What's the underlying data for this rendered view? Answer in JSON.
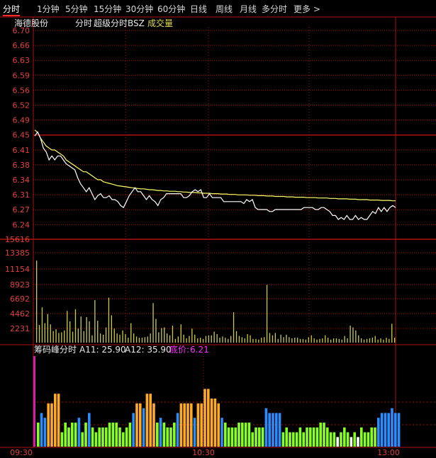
{
  "tabs": [
    {
      "label": "分时",
      "active": true
    },
    {
      "label": "1分钟"
    },
    {
      "label": "5分钟"
    },
    {
      "label": "15分钟"
    },
    {
      "label": "30分钟"
    },
    {
      "label": "60分钟"
    },
    {
      "label": "日线"
    },
    {
      "label": "周线"
    },
    {
      "label": "月线"
    },
    {
      "label": "多分时"
    },
    {
      "label": "更多 >"
    }
  ],
  "header": {
    "stock": "海德股份",
    "mode": "分时",
    "indicator": "超级分时BSZ",
    "volume": "成交量"
  },
  "price_ticks": [
    "6.70",
    "6.66",
    "6.63",
    "6.59",
    "6.56",
    "6.52",
    "6.49",
    "6.45",
    "6.41",
    "6.38",
    "6.34",
    "6.31",
    "6.27",
    "6.24"
  ],
  "volume_ticks": [
    "15616",
    "13385",
    "11154",
    "8923",
    "6692",
    "4462",
    "2231"
  ],
  "indicator_header": {
    "name": "筹码峰分时",
    "a11_label": "A11: 25.90",
    "a12_label": "A12: 35.90",
    "floor_label": "底价:",
    "floor_value": "6.21"
  },
  "time_labels": [
    "09:30",
    "10:30",
    "13:00"
  ],
  "colors": {
    "price_line": "#ffffff",
    "avg_line": "#ffff66",
    "grid": "#b01010",
    "volume": "#cccc44",
    "floor": "#ff33ff",
    "bar_orange": "#ffaa22",
    "bar_blue": "#2a8cff",
    "bar_green": "#88ff22"
  },
  "chart_data": [
    {
      "type": "line",
      "title": "",
      "ylim": [
        6.2133,
        6.71
      ],
      "series": [
        {
          "values": [
            6.435,
            6.445,
            6.43,
            6.405,
            6.395,
            6.375,
            6.385,
            6.375,
            6.385,
            6.385,
            6.375,
            6.365,
            6.36,
            6.355,
            6.35,
            6.33,
            6.315,
            6.305,
            6.295,
            6.305,
            6.29,
            6.275,
            6.285,
            6.29,
            6.28,
            6.28,
            6.285,
            6.275,
            6.275,
            6.27,
            6.26,
            6.255,
            6.27,
            6.285,
            6.295,
            6.305,
            6.295,
            6.295,
            6.285,
            6.275,
            6.285,
            6.275,
            6.27,
            6.26,
            6.275,
            6.28,
            6.29,
            6.29,
            6.29,
            6.29,
            6.29,
            6.29,
            6.28,
            6.28,
            6.285,
            6.295,
            6.3,
            6.295,
            6.3,
            6.28,
            6.28,
            6.29,
            6.28,
            6.28,
            6.28,
            6.28,
            6.27,
            6.27,
            6.27,
            6.27,
            6.27,
            6.27,
            6.27,
            6.265,
            6.275,
            6.27,
            6.275,
            6.255,
            6.25,
            6.25,
            6.25,
            6.25,
            6.245,
            6.245,
            6.25,
            6.25,
            6.25,
            6.25,
            6.25,
            6.25,
            6.25,
            6.25,
            6.25,
            6.25,
            6.255,
            6.255,
            6.255,
            6.255,
            6.25,
            6.25,
            6.255,
            6.255,
            6.25,
            6.245,
            6.235,
            6.235,
            6.225,
            6.23,
            6.225,
            6.235,
            6.225,
            6.225,
            6.235,
            6.225,
            6.23,
            6.225,
            6.225,
            6.235,
            6.245,
            6.24,
            6.255,
            6.245,
            6.255,
            6.245,
            6.255,
            6.26,
            6.255
          ]
        },
        {
          "values": [
            6.45,
            6.445,
            6.43,
            6.42,
            6.41,
            6.405,
            6.4,
            6.4,
            6.395,
            6.39,
            6.385,
            6.375,
            6.37,
            6.365,
            6.36,
            6.355,
            6.35,
            6.345,
            6.345,
            6.34,
            6.335,
            6.33,
            6.325,
            6.325,
            6.32,
            6.318,
            6.316,
            6.314,
            6.312,
            6.31,
            6.309,
            6.308,
            6.307,
            6.306,
            6.305,
            6.304,
            6.303,
            6.302,
            6.302,
            6.301,
            6.3,
            6.3,
            6.299,
            6.298,
            6.298,
            6.297,
            6.297,
            6.296,
            6.296,
            6.296,
            6.295,
            6.295,
            6.294,
            6.294,
            6.293,
            6.293,
            6.293,
            6.292,
            6.292,
            6.291,
            6.291,
            6.291,
            6.29,
            6.29,
            6.29,
            6.289,
            6.289,
            6.289,
            6.288,
            6.288,
            6.288,
            6.287,
            6.287,
            6.287,
            6.287,
            6.286,
            6.286,
            6.286,
            6.285,
            6.285,
            6.285,
            6.284,
            6.284,
            6.284,
            6.283,
            6.283,
            6.283,
            6.283,
            6.282,
            6.282,
            6.282,
            6.281,
            6.281,
            6.281,
            6.281,
            6.28,
            6.28,
            6.28,
            6.28,
            6.279,
            6.279,
            6.279,
            6.279,
            6.278,
            6.278,
            6.278,
            6.277,
            6.277,
            6.277,
            6.277,
            6.276,
            6.276,
            6.276,
            6.275,
            6.275,
            6.275,
            6.275,
            6.274,
            6.274,
            6.274,
            6.274,
            6.273,
            6.273,
            6.273,
            6.273,
            6.272,
            6.272
          ]
        }
      ]
    },
    {
      "type": "bar",
      "title": "",
      "ylim": [
        0,
        17000
      ],
      "values": [
        13500,
        2900,
        5800,
        3200,
        4700,
        3000,
        1900,
        2200,
        1600,
        1700,
        2000,
        5200,
        3500,
        1800,
        5500,
        2300,
        4300,
        1900,
        4200,
        3500,
        1200,
        7000,
        3600,
        1500,
        1300,
        2500,
        7400,
        4500,
        2300,
        1500,
        1300,
        2000,
        1400,
        800,
        3200,
        1500,
        1000,
        800,
        800,
        900,
        1000,
        1500,
        6500,
        3900,
        1700,
        2400,
        2500,
        1500,
        1200,
        2800,
        600,
        1000,
        3000,
        1300,
        700,
        1100,
        2300,
        1300,
        700,
        800,
        600,
        1100,
        1200,
        1200,
        1800,
        1400,
        800,
        1000,
        800,
        600,
        1100,
        5000,
        1900,
        1100,
        900,
        700,
        1400,
        1200,
        600,
        600,
        500,
        800,
        900,
        9500,
        1600,
        1200,
        1600,
        600,
        1300,
        900,
        1300,
        900,
        700,
        800,
        800,
        600,
        600,
        500,
        900,
        1200,
        700,
        500,
        600,
        700,
        1200,
        800,
        500,
        700,
        700,
        600,
        500,
        1100,
        700,
        2800,
        2500,
        2000,
        1200,
        700,
        500,
        600,
        700,
        800,
        1100,
        500,
        700,
        500,
        800,
        600,
        3100,
        800
      ]
    },
    {
      "type": "bar",
      "title": "",
      "ylim": [
        0,
        20
      ],
      "values": [
        5,
        7,
        6,
        9,
        9,
        11,
        11,
        3,
        5,
        4,
        5,
        5,
        6,
        3,
        5,
        7,
        4,
        3,
        4,
        4,
        4,
        5,
        5,
        5,
        4,
        3,
        4,
        5,
        7,
        9,
        9,
        8,
        11,
        11,
        9,
        5,
        6,
        5,
        4,
        4,
        5,
        7,
        9,
        9,
        9,
        9,
        6,
        9,
        9,
        12,
        12,
        10,
        10,
        9,
        6,
        5,
        4,
        4,
        4,
        5,
        5,
        5,
        5,
        3,
        4,
        4,
        4,
        8,
        7,
        7,
        7,
        7,
        3,
        4,
        3,
        3,
        3,
        4,
        3,
        4,
        4,
        4,
        4,
        5,
        5,
        4,
        3,
        3,
        2,
        3,
        4,
        3,
        2,
        3,
        2,
        4,
        3,
        3,
        4,
        4,
        6,
        7,
        7,
        7,
        8,
        7,
        7
      ]
    }
  ]
}
